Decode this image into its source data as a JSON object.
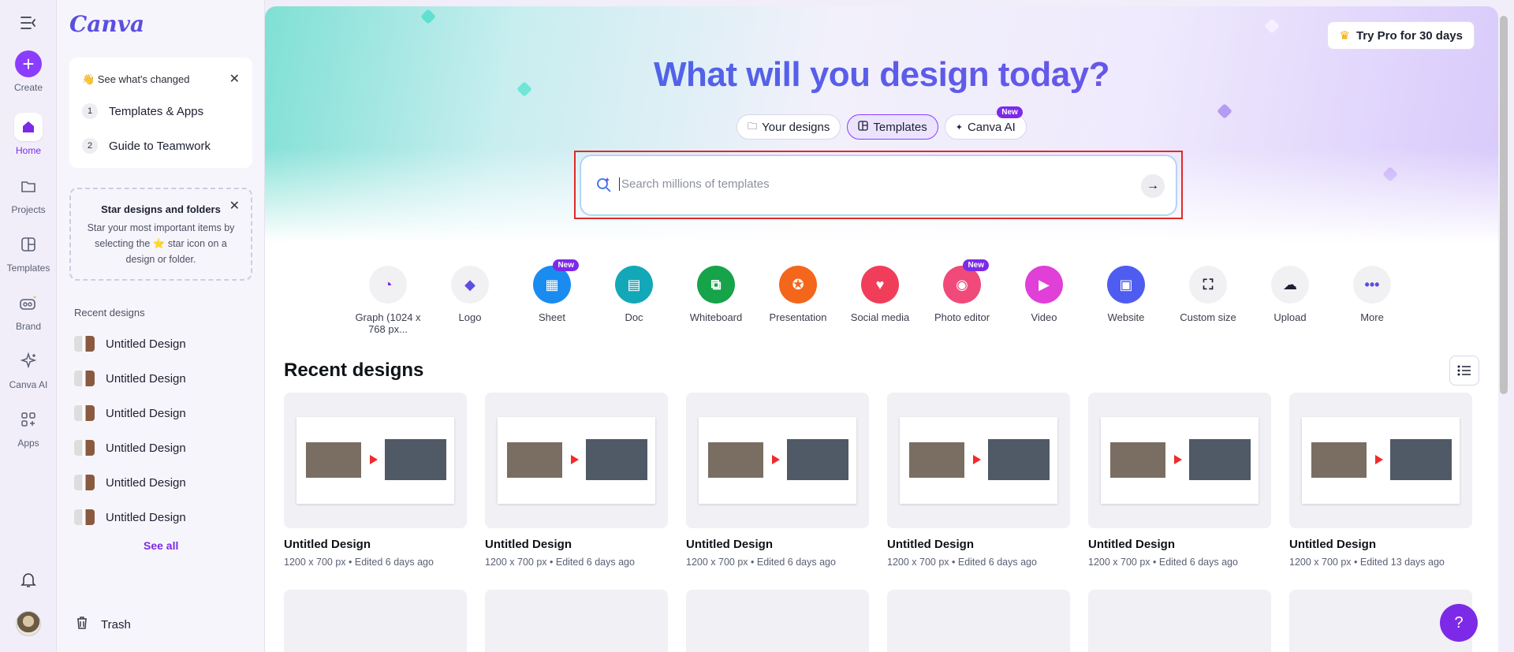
{
  "rail": {
    "items": [
      {
        "label": "Create",
        "icon": "plus-icon"
      },
      {
        "label": "Home",
        "icon": "home-icon"
      },
      {
        "label": "Projects",
        "icon": "folder-icon"
      },
      {
        "label": "Templates",
        "icon": "templates-icon"
      },
      {
        "label": "Brand",
        "icon": "brand-icon"
      },
      {
        "label": "Canva AI",
        "icon": "sparkles-icon"
      },
      {
        "label": "Apps",
        "icon": "apps-icon"
      }
    ]
  },
  "panel": {
    "logo": "Canva",
    "whats_changed": {
      "title": "👋 See what's changed",
      "steps": [
        {
          "num": "1",
          "label": "Templates & Apps"
        },
        {
          "num": "2",
          "label": "Guide to Teamwork"
        }
      ]
    },
    "star_tip": {
      "title": "Star designs and folders",
      "body": "Star your most important items by selecting the ⭐ star icon on a design or folder."
    },
    "recent_label": "Recent designs",
    "recent_items": [
      "Untitled Design",
      "Untitled Design",
      "Untitled Design",
      "Untitled Design",
      "Untitled Design",
      "Untitled Design"
    ],
    "see_all": "See all",
    "trash": "Trash"
  },
  "header": {
    "try_pro": "Try Pro for 30 days",
    "headline": "What will you design today?",
    "tabs": [
      {
        "label": "Your designs",
        "active": false
      },
      {
        "label": "Templates",
        "active": true
      },
      {
        "label": "Canva AI",
        "active": false,
        "badge": "New"
      }
    ],
    "search_placeholder": "Search millions of templates"
  },
  "shortcuts": [
    {
      "label": "Graph (1024 x 768 px...",
      "color": "#f1f1f4",
      "fg": "#7d2ae8",
      "glyph": "◔"
    },
    {
      "label": "Logo",
      "color": "#f1f1f4",
      "fg": "#5b4fe0",
      "glyph": "◆"
    },
    {
      "label": "Sheet",
      "color": "#1a8cf0",
      "fg": "#ffffff",
      "glyph": "▦",
      "badge": "New"
    },
    {
      "label": "Doc",
      "color": "#13a8b8",
      "fg": "#ffffff",
      "glyph": "▤"
    },
    {
      "label": "Whiteboard",
      "color": "#16a34a",
      "fg": "#ffffff",
      "glyph": "⧉"
    },
    {
      "label": "Presentation",
      "color": "#f4661b",
      "fg": "#ffffff",
      "glyph": "✪"
    },
    {
      "label": "Social media",
      "color": "#f03e5a",
      "fg": "#ffffff",
      "glyph": "♥"
    },
    {
      "label": "Photo editor",
      "color": "#f04a7a",
      "fg": "#ffffff",
      "glyph": "◉",
      "badge": "New"
    },
    {
      "label": "Video",
      "color": "#e040d8",
      "fg": "#ffffff",
      "glyph": "▶"
    },
    {
      "label": "Website",
      "color": "#4f5cf0",
      "fg": "#ffffff",
      "glyph": "▣"
    },
    {
      "label": "Custom size",
      "color": "#f1f1f4",
      "fg": "#1d2030",
      "glyph": "⛶"
    },
    {
      "label": "Upload",
      "color": "#f1f1f4",
      "fg": "#1d2030",
      "glyph": "☁"
    },
    {
      "label": "More",
      "color": "#f1f1f4",
      "fg": "#5b4fe0",
      "glyph": "•••"
    }
  ],
  "recent": {
    "title": "Recent designs",
    "designs": [
      {
        "name": "Untitled Design",
        "meta": "1200 x 700 px • Edited 6 days ago"
      },
      {
        "name": "Untitled Design",
        "meta": "1200 x 700 px • Edited 6 days ago"
      },
      {
        "name": "Untitled Design",
        "meta": "1200 x 700 px • Edited 6 days ago"
      },
      {
        "name": "Untitled Design",
        "meta": "1200 x 700 px • Edited 6 days ago"
      },
      {
        "name": "Untitled Design",
        "meta": "1200 x 700 px • Edited 6 days ago"
      },
      {
        "name": "Untitled Design",
        "meta": "1200 x 700 px • Edited 13 days ago"
      }
    ]
  },
  "help": "?"
}
